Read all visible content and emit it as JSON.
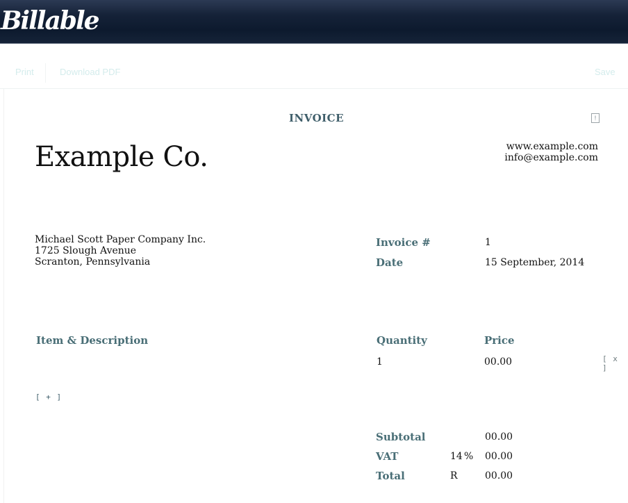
{
  "app": {
    "logo": "Billable"
  },
  "toolbar": {
    "print": "Print",
    "download_pdf": "Download PDF",
    "save": "Save"
  },
  "invoice": {
    "title": "INVOICE",
    "info_icon": "info-icon",
    "company_name": "Example Co.",
    "website": "www.example.com",
    "email": "info@example.com",
    "client": {
      "name": "Michael Scott Paper Company Inc.",
      "street": "1725 Slough Avenue",
      "city": "Scranton, Pennsylvania"
    },
    "meta": {
      "number_label": "Invoice #",
      "number": "1",
      "date_label": "Date",
      "date": "15 September, 2014"
    },
    "items": {
      "headers": {
        "description": "Item & Description",
        "quantity": "Quantity",
        "price": "Price"
      },
      "rows": [
        {
          "description": "",
          "quantity": "1",
          "price": "00.00",
          "remove": "[ x ]"
        }
      ],
      "add": "[ + ]"
    },
    "totals": {
      "subtotal_label": "Subtotal",
      "subtotal": "00.00",
      "vat_label": "VAT",
      "vat_rate": "14",
      "vat_percent_sign": "%",
      "vat": "00.00",
      "total_label": "Total",
      "currency": "R",
      "total": "00.00"
    }
  }
}
